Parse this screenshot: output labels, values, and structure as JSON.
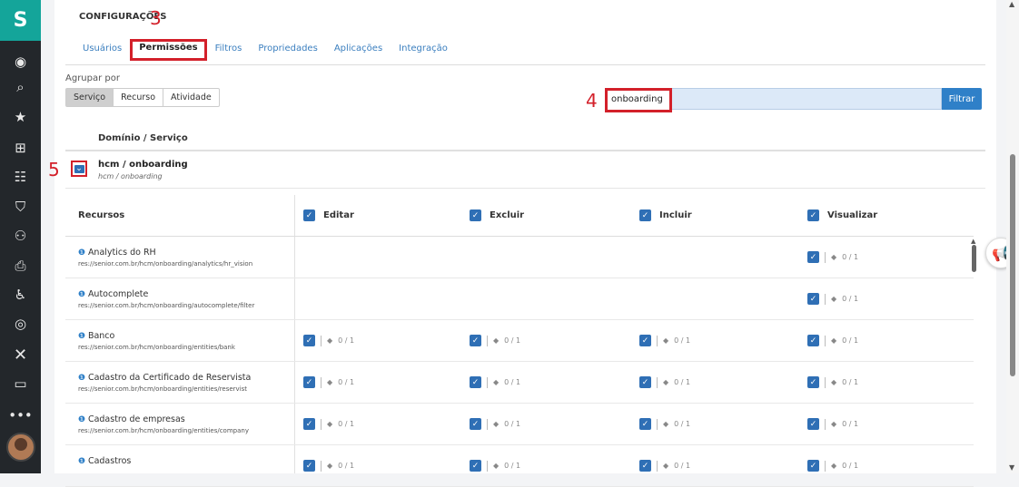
{
  "sidebar": {
    "icons": [
      "logo-icon",
      "user-circle-icon",
      "search-icon",
      "star-icon",
      "org-chart-icon",
      "people-list-icon",
      "shield-icon",
      "group-icon",
      "print-icon",
      "person-accessible-icon",
      "target-icon",
      "x-icon",
      "monitor-icon",
      "more-icon"
    ],
    "logo_glyph": "S"
  },
  "annotations": {
    "n3": "3",
    "n4": "4",
    "n5": "5"
  },
  "header": {
    "title": "CONFIGURAÇÕES"
  },
  "tabs": [
    {
      "label": "Usuários"
    },
    {
      "label": "Permissões"
    },
    {
      "label": "Filtros"
    },
    {
      "label": "Propriedades"
    },
    {
      "label": "Aplicações"
    },
    {
      "label": "Integração"
    }
  ],
  "group_by": {
    "label": "Agrupar por",
    "options": [
      "Serviço",
      "Recurso",
      "Atividade"
    ],
    "selected": "Serviço"
  },
  "search": {
    "value": "onboarding",
    "button": "Filtrar"
  },
  "domain_header": "Domínio / Serviço",
  "domain": {
    "name": "hcm / onboarding",
    "sub": "hcm / onboarding"
  },
  "table": {
    "resources_header": "Recursos",
    "permissions": [
      "Editar",
      "Excluir",
      "Incluir",
      "Visualizar"
    ],
    "count_text": "0 / 1",
    "rows": [
      {
        "title": "Analytics do RH",
        "path": "res://senior.com.br/hcm/onboarding/analytics/hr_vision",
        "cells": [
          false,
          false,
          false,
          true
        ]
      },
      {
        "title": "Autocomplete",
        "path": "res://senior.com.br/hcm/onboarding/autocomplete/filter",
        "cells": [
          false,
          false,
          false,
          true
        ]
      },
      {
        "title": "Banco",
        "path": "res://senior.com.br/hcm/onboarding/entities/bank",
        "cells": [
          true,
          true,
          true,
          true
        ]
      },
      {
        "title": "Cadastro da Certificado de Reservista",
        "path": "res://senior.com.br/hcm/onboarding/entities/reservist",
        "cells": [
          true,
          true,
          true,
          true
        ]
      },
      {
        "title": "Cadastro de empresas",
        "path": "res://senior.com.br/hcm/onboarding/entities/company",
        "cells": [
          true,
          true,
          true,
          true
        ]
      },
      {
        "title": "Cadastros",
        "path": "",
        "cells": [
          true,
          true,
          true,
          true
        ]
      }
    ]
  }
}
